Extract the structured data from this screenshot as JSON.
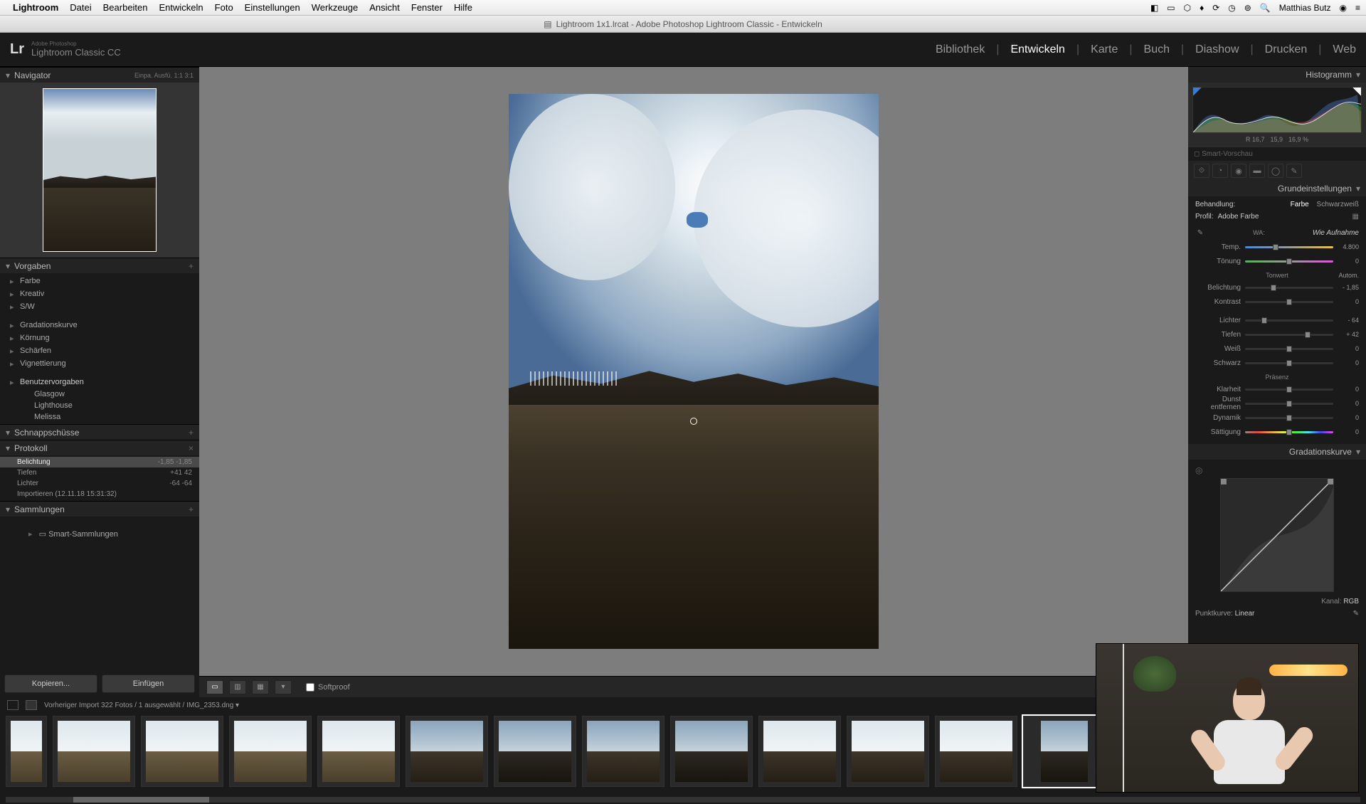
{
  "mac": {
    "app": "Lightroom",
    "menu": [
      "Datei",
      "Bearbeiten",
      "Entwickeln",
      "Foto",
      "Einstellungen",
      "Werkzeuge",
      "Ansicht",
      "Fenster",
      "Hilfe"
    ],
    "user": "Matthias Butz"
  },
  "window": {
    "title": "Lightroom 1x1.lrcat - Adobe Photoshop Lightroom Classic - Entwickeln"
  },
  "header": {
    "logo": "Lr",
    "sub_small": "Adobe Photoshop",
    "sub": "Lightroom Classic CC",
    "modules": [
      "Bibliothek",
      "Entwickeln",
      "Karte",
      "Buch",
      "Diashow",
      "Drucken",
      "Web"
    ],
    "active_module": "Entwickeln"
  },
  "left": {
    "navigator": {
      "title": "Navigator",
      "zoom_opts": "Einpa.   Ausfü.   1:1   3:1"
    },
    "vorgaben": {
      "title": "Vorgaben",
      "groups": [
        "Farbe",
        "Kreativ",
        "S/W"
      ],
      "groups2": [
        "Gradationskurve",
        "Körnung",
        "Schärfen",
        "Vignettierung"
      ],
      "user_group": "Benutzervorgaben",
      "user_presets": [
        "Glasgow",
        "Lighthouse",
        "Melissa"
      ]
    },
    "snapshots": {
      "title": "Schnappschüsse"
    },
    "protokoll": {
      "title": "Protokoll",
      "items": [
        {
          "label": "Belichtung",
          "val": "-1,85    -1,85",
          "active": true
        },
        {
          "label": "Tiefen",
          "val": "+41    42"
        },
        {
          "label": "Lichter",
          "val": "-64    -64"
        },
        {
          "label": "Importieren (12.11.18 15:31:32)",
          "val": ""
        }
      ]
    },
    "sammlungen": {
      "title": "Sammlungen",
      "smart": "Smart-Sammlungen"
    },
    "buttons": {
      "copy": "Kopieren...",
      "paste": "Einfügen"
    }
  },
  "toolbar": {
    "softproof": "Softproof"
  },
  "right": {
    "histogram": {
      "title": "Histogramm",
      "vals": [
        "R   16,7",
        "15,9",
        "16,9 %"
      ],
      "smart": "Smart-Vorschau"
    },
    "basic": {
      "title": "Grundeinstellungen",
      "treatment_label": "Behandlung:",
      "treatment_color": "Farbe",
      "treatment_bw": "Schwarzweiß",
      "profile_label": "Profil:",
      "profile_value": "Adobe Farbe",
      "wb_label": "WA:",
      "wb_value": "Wie Aufnahme",
      "tone_divider": "Tonwert",
      "tone_auto": "Autom.",
      "presence_divider": "Präsenz",
      "sliders": {
        "temp": {
          "label": "Temp.",
          "val": "4.800",
          "pos": 35
        },
        "tint": {
          "label": "Tönung",
          "val": "0",
          "pos": 50
        },
        "exposure": {
          "label": "Belichtung",
          "val": "- 1,85",
          "pos": 32
        },
        "contrast": {
          "label": "Kontrast",
          "val": "0",
          "pos": 50
        },
        "highlights": {
          "label": "Lichter",
          "val": "- 64",
          "pos": 22
        },
        "shadows": {
          "label": "Tiefen",
          "val": "+ 42",
          "pos": 71
        },
        "whites": {
          "label": "Weiß",
          "val": "0",
          "pos": 50
        },
        "blacks": {
          "label": "Schwarz",
          "val": "0",
          "pos": 50
        },
        "clarity": {
          "label": "Klarheit",
          "val": "0",
          "pos": 50
        },
        "dehaze": {
          "label": "Dunst entfernen",
          "val": "0",
          "pos": 50
        },
        "vibrance": {
          "label": "Dynamik",
          "val": "0",
          "pos": 50
        },
        "saturation": {
          "label": "Sättigung",
          "val": "0",
          "pos": 50
        }
      }
    },
    "curve": {
      "title": "Gradationskurve",
      "channel_label": "Kanal:",
      "channel": "RGB",
      "point_label": "Punktkurve:",
      "point": "Linear"
    }
  },
  "filmstrip": {
    "info": "Vorheriger Import    322 Fotos / 1 ausgewählt /  IMG_2353.dng  ▾"
  }
}
